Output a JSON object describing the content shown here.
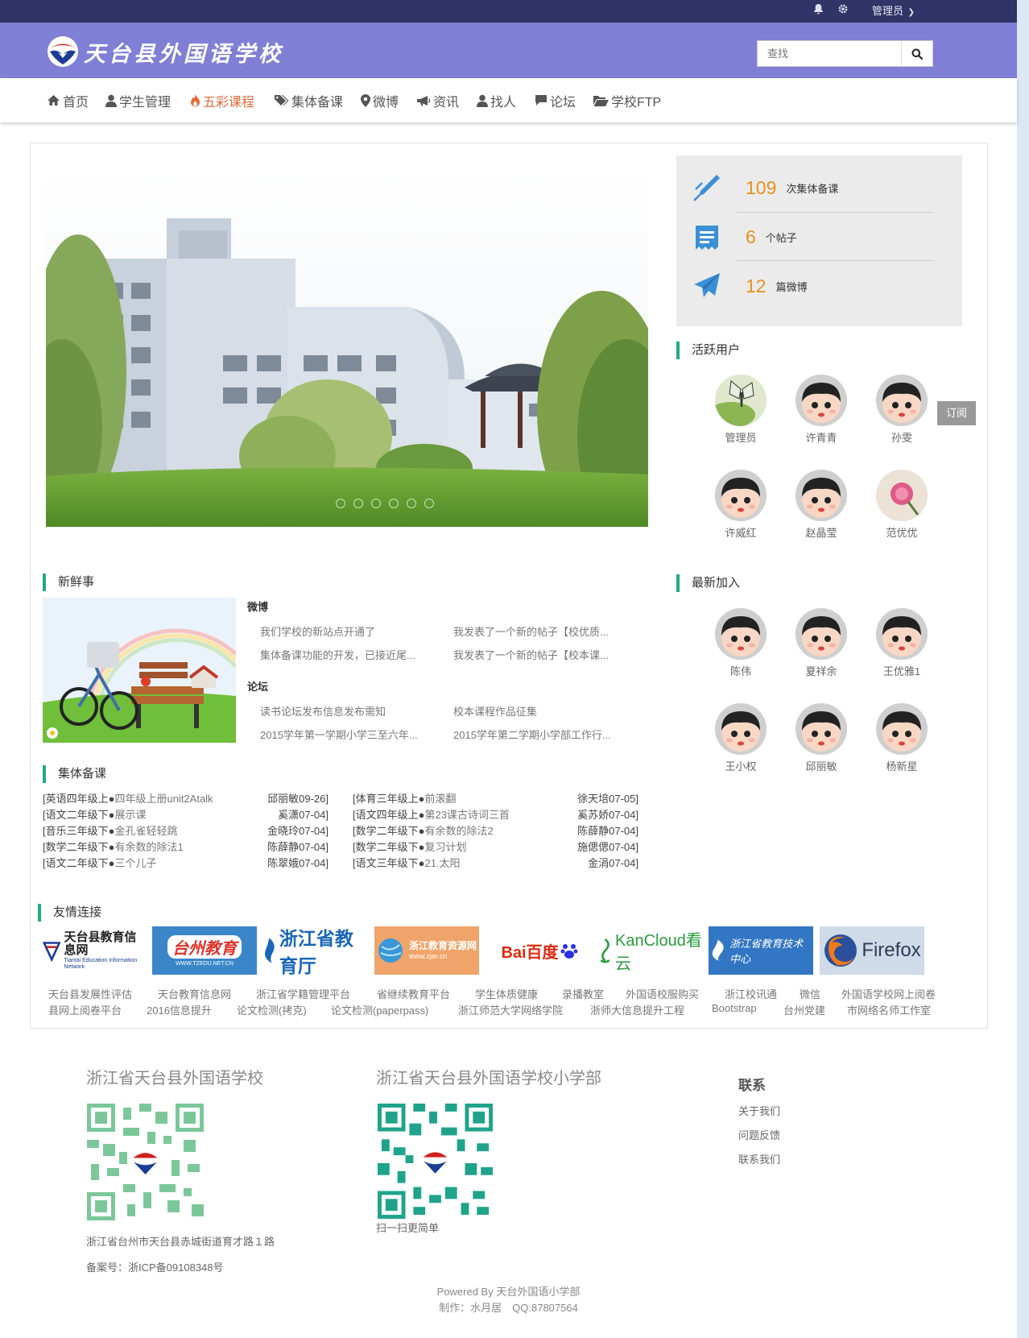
{
  "topbar": {
    "bell_icon": "bell-icon",
    "gear_icon": "gear-icon",
    "user_label": "管理员",
    "bg_color": "#303466"
  },
  "header": {
    "logo_text": "天台县外国语学校",
    "search_placeholder": "查找",
    "bg_color": "#7f7fd5"
  },
  "nav": {
    "items": [
      {
        "label": "首页",
        "icon": "home-icon"
      },
      {
        "label": "学生管理",
        "icon": "user-icon"
      },
      {
        "label": "五彩课程",
        "icon": "fire-icon"
      },
      {
        "label": "集体备课",
        "icon": "tags-icon"
      },
      {
        "label": "微博",
        "icon": "map-marker-icon"
      },
      {
        "label": "资讯",
        "icon": "bullhorn-icon"
      },
      {
        "label": "找人",
        "icon": "user-icon"
      },
      {
        "label": "论坛",
        "icon": "comment-icon"
      },
      {
        "label": "学校FTP",
        "icon": "folder-open-icon"
      }
    ],
    "active_color": "#e46a3c"
  },
  "stats": [
    {
      "num": "109",
      "label": "次集体备课",
      "icon": "pen-icon"
    },
    {
      "num": "6",
      "label": "个帖子",
      "icon": "receipt-icon"
    },
    {
      "num": "12",
      "label": "篇微博",
      "icon": "paper-plane-icon"
    }
  ],
  "active_users": {
    "title": "活跃用户",
    "users": [
      "管理员",
      "许青青",
      "孙雯",
      "许威红",
      "赵晶莹",
      "范优优"
    ]
  },
  "subscribe_label": "订阅",
  "latest_join": {
    "title": "最新加入",
    "users": [
      "陈伟",
      "夏祥余",
      "王优雅1",
      "王小权",
      "邱丽敏",
      "杨新星"
    ]
  },
  "news": {
    "title": "新鲜事",
    "weibo_title": "微博",
    "weibo_links": [
      "我们学校的新站点开通了",
      "我发表了一个新的帖子【校优质...",
      "集体备课功能的开发，已接近尾...",
      "我发表了一个新的帖子【校本课..."
    ],
    "forum_title": "论坛",
    "forum_links": [
      "读书论坛发布信息发布需知",
      "校本课程作品征集",
      "2015学年第一学期小学三至六年...",
      "2015学年第二学期小学部工作行..."
    ]
  },
  "lessons": {
    "title": "集体备课",
    "left": [
      {
        "tag": "[英语四年级上●",
        "title": "四年级上册unit2Atalk",
        "meta": "邱丽敏09-26]"
      },
      {
        "tag": "[语文二年级下●",
        "title": "展示课",
        "meta": "奚潇07-04]"
      },
      {
        "tag": "[音乐三年级下●",
        "title": "金孔雀轻轻跳",
        "meta": "金晓玲07-04]"
      },
      {
        "tag": "[数学二年级下●",
        "title": "有余数的除法1",
        "meta": "陈薛静07-04]"
      },
      {
        "tag": "[语文二年级下●",
        "title": "三个儿子",
        "meta": "陈翠娥07-04]"
      }
    ],
    "right": [
      {
        "tag": "[体育三年级上●",
        "title": "前滚翻",
        "meta": "徐天培07-05]"
      },
      {
        "tag": "[语文四年级上●",
        "title": "第23课古诗词三首",
        "meta": "奚苏娇07-04]"
      },
      {
        "tag": "[数学二年级下●",
        "title": "有余数的除法2",
        "meta": "陈薛静07-04]"
      },
      {
        "tag": "[数学二年级下●",
        "title": "复习计划",
        "meta": "施偲偲07-04]"
      },
      {
        "tag": "[语文三年级下●",
        "title": "21.太阳",
        "meta": "金涓07-04]"
      }
    ]
  },
  "friends": {
    "title": "友情连接",
    "banners": [
      {
        "text": "天台县教育信息网",
        "sub": "Tiantai Education Information Network"
      },
      {
        "text": "台州教育",
        "sub": "WWW.TZEDU.NET.CN"
      },
      {
        "text": "浙江省教育厅",
        "sub": ""
      },
      {
        "text": "浙江教育资源网",
        "sub": "www.zjer.cn"
      },
      {
        "text": "Bai百度",
        "sub": ""
      },
      {
        "text": "KanCloud看云",
        "sub": ""
      },
      {
        "text": "浙江省教育技术中心",
        "sub": ""
      },
      {
        "text": "Firefox",
        "sub": ""
      }
    ],
    "links_row1": [
      "天台县发展性评估",
      "天台教育信息网",
      "浙江省学籍管理平台",
      "省继续教育平台",
      "学生体质健康",
      "录播教室",
      "外国语校服购买",
      "浙江校讯通",
      "微信",
      "外国语学校网上阅卷"
    ],
    "links_row2": [
      "县网上阅卷平台",
      "2016信息提升",
      "论文检测(拷克)",
      "论文检测(paperpass)",
      "浙江师范大学网络学院",
      "浙师大信息提升工程",
      "Bootstrap",
      "台州党建",
      "市网络名师工作室"
    ]
  },
  "footer": {
    "col1_title": "浙江省天台县外国语学校",
    "col2_title": "浙江省天台县外国语学校小学部",
    "scan_text": "扫一扫更简单",
    "address": "浙江省台州市天台县赤城街道育才路１路",
    "icp": "备案号：浙ICP备09108348号",
    "contact_title": "联系",
    "contact_links": [
      "关于我们",
      "问题反馈",
      "联系我们"
    ],
    "powered": "Powered By 天台外国语小学部",
    "author": "制作：水月居　QQ:87807564"
  }
}
